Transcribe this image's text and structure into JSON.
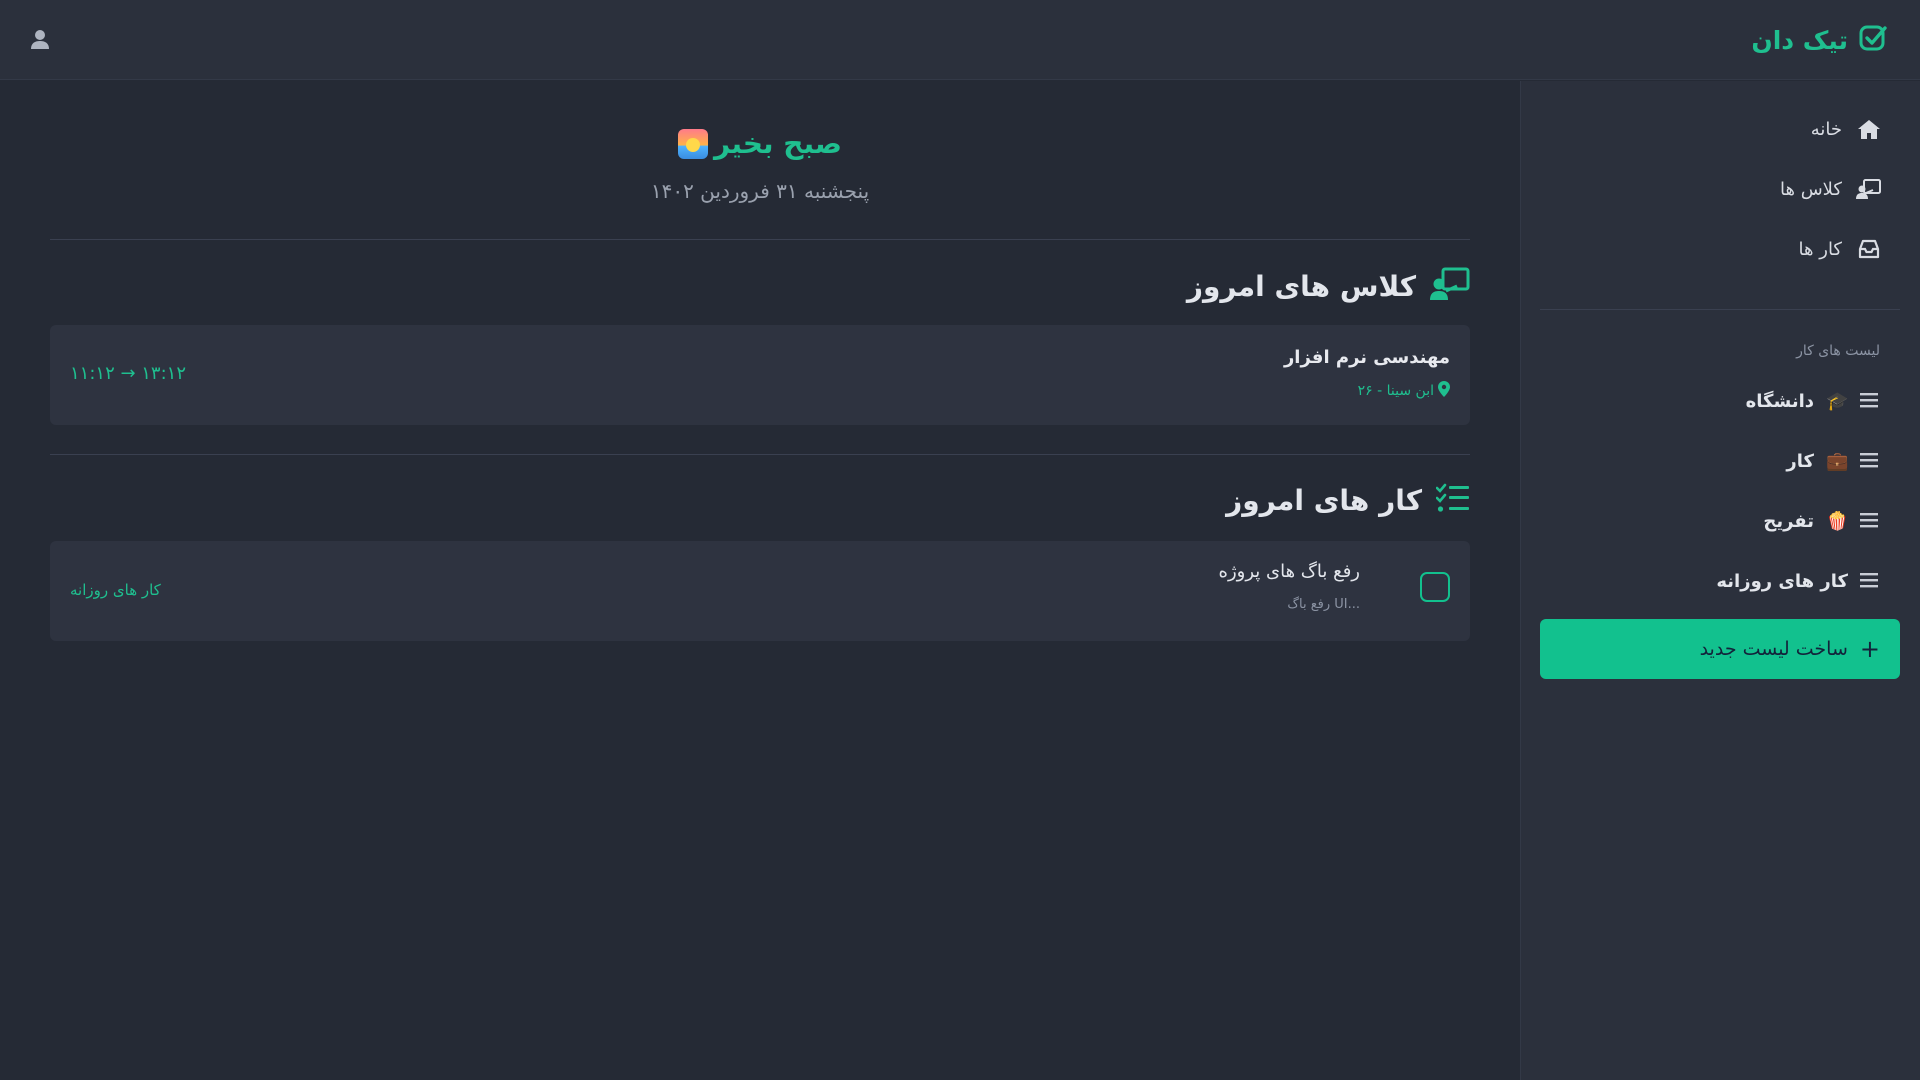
{
  "app": {
    "brand": "تیک دان",
    "accent": "#12c18e"
  },
  "header": {
    "user_icon": "user-icon"
  },
  "sidebar": {
    "nav": [
      {
        "label": "خانه",
        "icon": "home-icon"
      },
      {
        "label": "کلاس ها",
        "icon": "teacher-icon"
      },
      {
        "label": "کار ها",
        "icon": "inbox-icon"
      }
    ],
    "section_label": "لیست های کار",
    "lists": [
      {
        "label": "دانشگاه",
        "emoji": "🎓"
      },
      {
        "label": "کار",
        "emoji": "💼"
      },
      {
        "label": "تفریح",
        "emoji": "🍿"
      },
      {
        "label": "کار های روزانه",
        "emoji": ""
      }
    ],
    "new_list_label": "ساخت لیست جدید",
    "new_list_plus": "+"
  },
  "main": {
    "greeting": "صبح بخیر",
    "date": "پنجشنبه ۳۱ فروردین ۱۴۰۲",
    "classes_title": "کلاس های امروز",
    "classes": [
      {
        "name": "مهندسی نرم افزار",
        "location": "ابن سینا - ۲۶",
        "time": "۱۱:۱۲ → ۱۳:۱۲"
      }
    ],
    "tasks_title": "کار های امروز",
    "tasks": [
      {
        "title": "رفع باگ های پروژه",
        "subtitle": "رفع باگ UI...",
        "list": "کار های روزانه"
      }
    ]
  }
}
